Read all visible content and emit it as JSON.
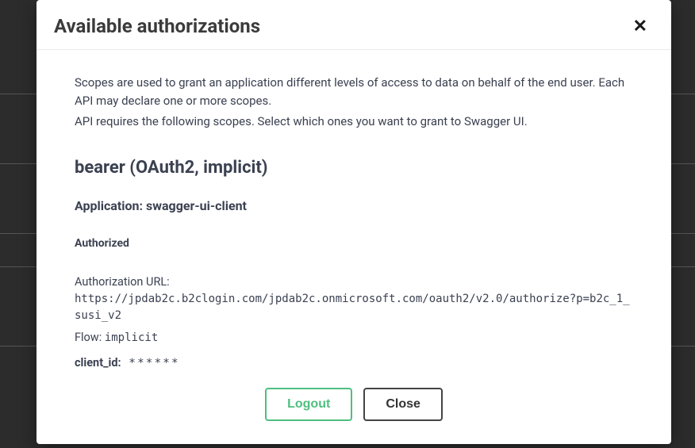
{
  "modal": {
    "title": "Available authorizations",
    "scopes_intro": "Scopes are used to grant an application different levels of access to data on behalf of the end user. Each API may declare one or more scopes.",
    "scopes_select": "API requires the following scopes. Select which ones you want to grant to Swagger UI.",
    "auth_title": "bearer (OAuth2, implicit)",
    "application_label": "Application:",
    "application_value": "swagger-ui-client",
    "status": "Authorized",
    "auth_url_label": "Authorization URL:",
    "auth_url_value": "https://jpdab2c.b2clogin.com/jpdab2c.onmicrosoft.com/oauth2/v2.0/authorize?p=b2c_1_susi_v2",
    "flow_label": "Flow:",
    "flow_value": "implicit",
    "client_id_label": "client_id:",
    "client_id_value": "******",
    "logout_label": "Logout",
    "close_label": "Close"
  }
}
